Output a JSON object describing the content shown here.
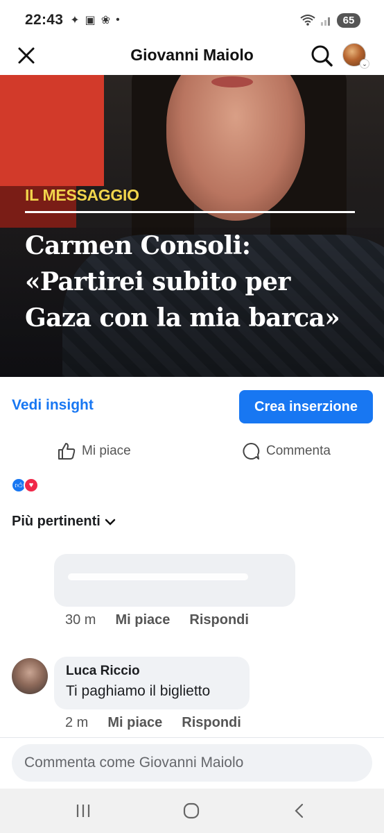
{
  "status_bar": {
    "time": "22:43",
    "battery": "65"
  },
  "header": {
    "title": "Giovanni Maiolo"
  },
  "post_image": {
    "kicker": "IL MESSAGGIO",
    "headline_lines": [
      "Carmen Consoli:",
      "«Partirei subito per",
      "Gaza con la mia barca»"
    ]
  },
  "insights": {
    "link_label": "Vedi insight",
    "create_ad_label": "Crea inserzione"
  },
  "actions": {
    "like_label": "Mi piace",
    "comment_label": "Commenta"
  },
  "sort": {
    "label": "Più pertinenti"
  },
  "comments": [
    {
      "author": "",
      "text": "",
      "time": "30 m",
      "like_label": "Mi piace",
      "reply_label": "Rispondi"
    },
    {
      "author": "Luca Riccio",
      "text": "Ti paghiamo il biglietto",
      "time": "2 m",
      "like_label": "Mi piace",
      "reply_label": "Rispondi"
    }
  ],
  "composer": {
    "placeholder": "Commenta come Giovanni Maiolo"
  },
  "colors": {
    "accent": "#1877f2",
    "kicker": "#f1d54c",
    "love": "#f02849"
  },
  "icons": {
    "close": "close-icon",
    "search": "search-icon",
    "like": "thumbs-up-icon",
    "comment": "comment-bubble-icon"
  }
}
